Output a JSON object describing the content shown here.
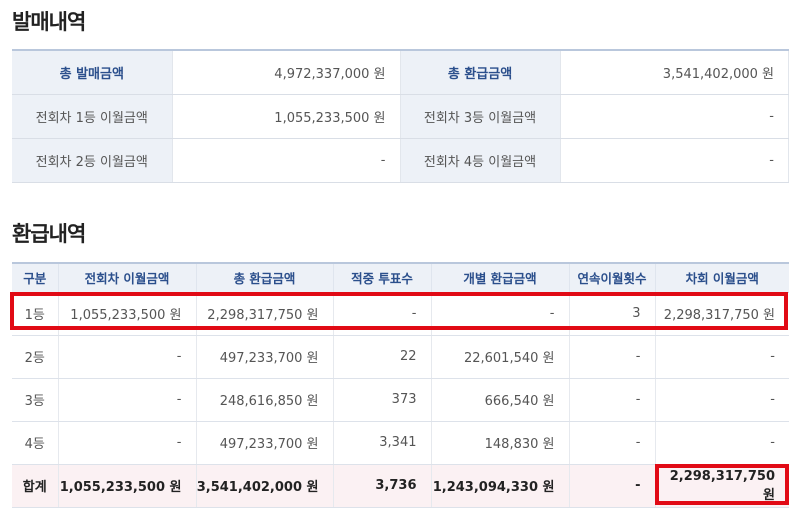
{
  "sale_section": {
    "title": "발매내역",
    "rows": [
      {
        "l1": "총 발매금액",
        "v1": "4,972,337,000 원",
        "l2": "총 환급금액",
        "v2": "3,541,402,000 원"
      },
      {
        "l1": "전회차 1등 이월금액",
        "v1": "1,055,233,500 원",
        "l2": "전회차 3등 이월금액",
        "v2": "-"
      },
      {
        "l1": "전회차 2등 이월금액",
        "v1": "-",
        "l2": "전회차 4등 이월금액",
        "v2": "-"
      }
    ]
  },
  "refund_section": {
    "title": "환급내역",
    "headers": [
      "구분",
      "전회차 이월금액",
      "총 환급금액",
      "적중 투표수",
      "개별 환급금액",
      "연속이월횟수",
      "차회 이월금액"
    ],
    "rows": [
      [
        "1등",
        "1,055,233,500 원",
        "2,298,317,750 원",
        "-",
        "-",
        "3",
        "2,298,317,750 원"
      ],
      [
        "2등",
        "-",
        "497,233,700 원",
        "22",
        "22,601,540 원",
        "-",
        "-"
      ],
      [
        "3등",
        "-",
        "248,616,850 원",
        "373",
        "666,540 원",
        "-",
        "-"
      ],
      [
        "4등",
        "-",
        "497,233,700 원",
        "3,341",
        "148,830 원",
        "-",
        "-"
      ],
      [
        "합계",
        "1,055,233,500 원",
        "3,541,402,000 원",
        "3,736",
        "1,243,094,330 원",
        "-",
        "2,298,317,750 원"
      ]
    ]
  },
  "colors": {
    "header_bg": "#edf1f7",
    "header_text": "#2b4f8c",
    "highlight_border": "#e10a15",
    "total_row_bg": "#fbf1f3"
  }
}
